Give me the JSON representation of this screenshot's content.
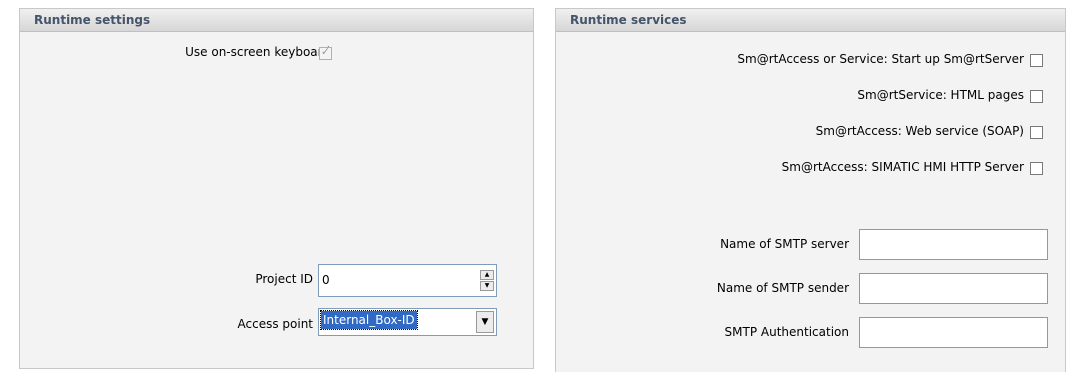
{
  "runtime_settings": {
    "title": "Runtime settings",
    "onscreen_keyboard": {
      "label": "Use on-screen keyboard",
      "checked": true,
      "enabled": false
    },
    "project_id": {
      "label": "Project ID",
      "value": "0"
    },
    "access_point": {
      "label": "Access point",
      "value": "Internal_Box-ID"
    }
  },
  "runtime_services": {
    "title": "Runtime services",
    "options": [
      {
        "label": "Sm@rtAccess or Service: Start up Sm@rtServer",
        "checked": false
      },
      {
        "label": "Sm@rtService: HTML pages",
        "checked": false
      },
      {
        "label": "Sm@rtAccess: Web service (SOAP)",
        "checked": false
      },
      {
        "label": "Sm@rtAccess: SIMATIC HMI HTTP Server",
        "checked": false
      }
    ],
    "fields": [
      {
        "label": "Name of SMTP server",
        "value": ""
      },
      {
        "label": "Name of SMTP sender",
        "value": ""
      },
      {
        "label": "SMTP Authentication",
        "value": ""
      }
    ]
  },
  "icons": {
    "check_mark": "✓",
    "spin_up": "▲",
    "spin_down": "▼",
    "dropdown": "▼"
  }
}
